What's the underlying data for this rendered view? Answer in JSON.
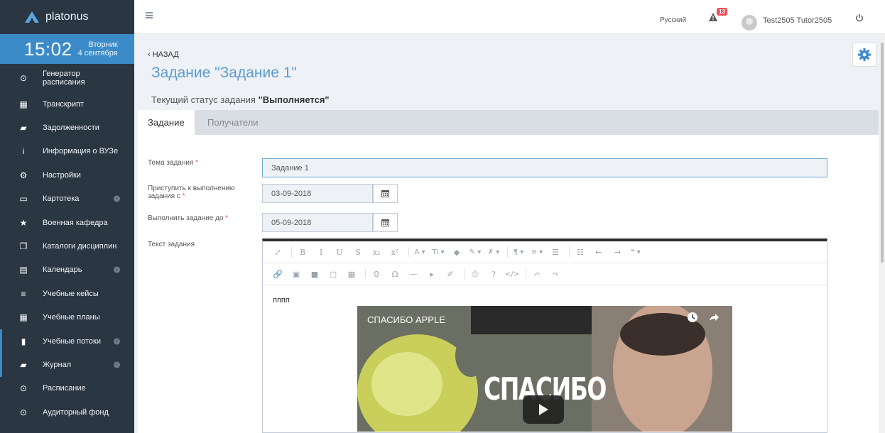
{
  "app": {
    "logo_text": "platonus"
  },
  "clock": {
    "time": "15:02",
    "weekday": "Вторник",
    "date": "4 сентября"
  },
  "sidebar": {
    "items": [
      {
        "label_line1": "Генератор",
        "label_line2": "расписания",
        "icon": "clock-icon",
        "has_submenu": false
      },
      {
        "label_line1": "Транскрипт",
        "label_line2": "",
        "icon": "table-icon",
        "has_submenu": false
      },
      {
        "label_line1": "Задолженности",
        "label_line2": "",
        "icon": "inbox-icon",
        "has_submenu": false
      },
      {
        "label_line1": "Информация о ВУЗе",
        "label_line2": "",
        "icon": "info-icon",
        "has_submenu": false
      },
      {
        "label_line1": "Настройки",
        "label_line2": "",
        "icon": "cogs-icon",
        "has_submenu": false
      },
      {
        "label_line1": "Картотека",
        "label_line2": "",
        "icon": "folder-open-icon",
        "has_submenu": true
      },
      {
        "label_line1": "Военная кафедра",
        "label_line2": "",
        "icon": "star-icon",
        "has_submenu": false
      },
      {
        "label_line1": "Каталоги дисциплин",
        "label_line2": "",
        "icon": "copy-icon",
        "has_submenu": false
      },
      {
        "label_line1": "Календарь",
        "label_line2": "",
        "icon": "calendar-icon",
        "has_submenu": true
      },
      {
        "label_line1": "Учебные кейсы",
        "label_line2": "",
        "icon": "list-icon",
        "has_submenu": false
      },
      {
        "label_line1": "Учебные планы",
        "label_line2": "",
        "icon": "grid-icon",
        "has_submenu": false
      },
      {
        "label_line1": "Учебные потоки",
        "label_line2": "",
        "icon": "file-icon",
        "has_submenu": true
      },
      {
        "label_line1": "Журнал",
        "label_line2": "",
        "icon": "book-icon",
        "has_submenu": true
      },
      {
        "label_line1": "Расписание",
        "label_line2": "",
        "icon": "clock-icon",
        "has_submenu": false
      },
      {
        "label_line1": "Аудиторный фонд",
        "label_line2": "",
        "icon": "clock-icon",
        "has_submenu": false
      }
    ]
  },
  "topbar": {
    "language": "Русский",
    "notifications_count": "13",
    "username": "Test2505 Tutor2505"
  },
  "page": {
    "back_label": "НАЗАД",
    "title": "Задание \"Задание 1\"",
    "status_prefix": "Текущий статус задания ",
    "status_value": "\"Выполняется\""
  },
  "tabs": [
    {
      "label": "Задание",
      "active": true
    },
    {
      "label": "Получатели",
      "active": false
    }
  ],
  "form": {
    "topic_label": "Тема задания",
    "topic_value": "Задание 1",
    "start_label_line1": "Приступить к выполнению",
    "start_label_line2": "задания с",
    "start_value": "03-09-2018",
    "due_label": "Выполнить задание до",
    "due_value": "05-09-2018",
    "text_label": "Текст задания",
    "required_mark": "*"
  },
  "editor": {
    "content_text": "пппп",
    "video_title": "СПАСИБО APPLE",
    "video_overlay_text": "СПАСИБО",
    "toolbar_row1": [
      "⤢",
      "B",
      "I",
      "U",
      "S",
      "x₂",
      "x²",
      "A ▾",
      "TI ▾",
      "◆",
      "✎ ▾",
      "✗ ▾",
      "¶ ▾",
      "≡ ▾",
      "☰",
      "☷",
      "⇤",
      "⇥",
      "❝ ▾"
    ],
    "toolbar_row2": [
      "🔗",
      "▣",
      "■",
      "▢",
      "▦",
      "☺",
      "Ω",
      "—",
      "▸",
      "✐",
      "⎙",
      "?",
      "</>",
      "↶",
      "↷"
    ]
  }
}
